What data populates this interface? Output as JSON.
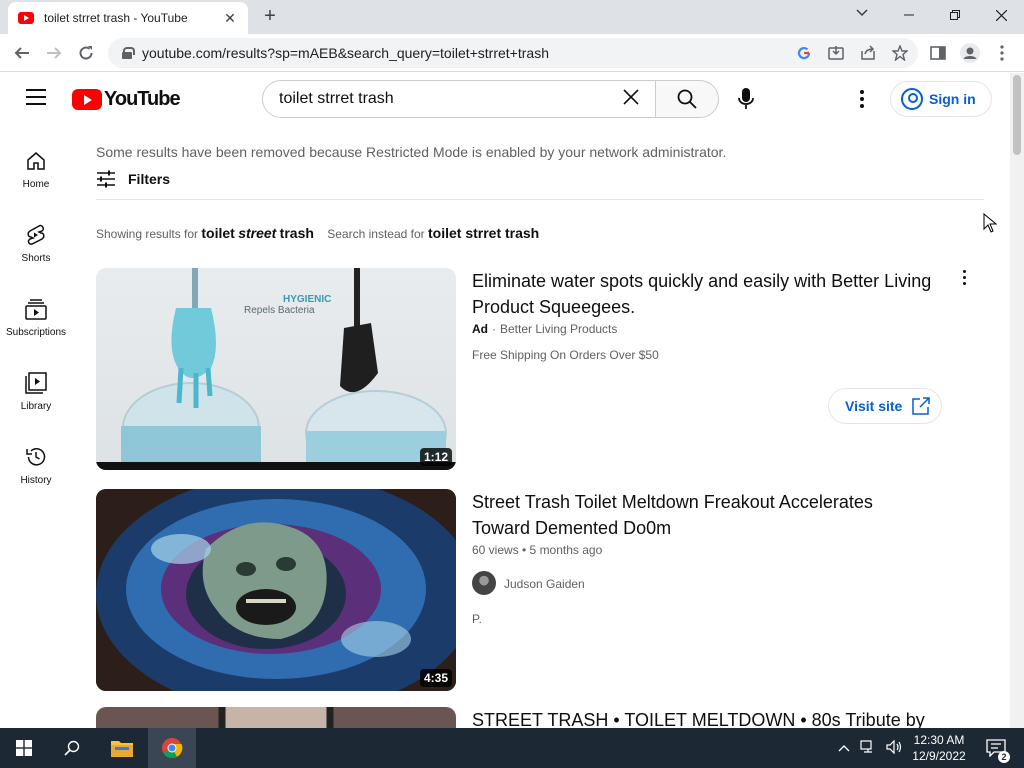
{
  "browser": {
    "tab_title": "toilet strret trash - YouTube",
    "url": "youtube.com/results?sp=mAEB&search_query=toilet+strret+trash"
  },
  "header": {
    "logo_text": "YouTube",
    "search_value": "toilet strret trash",
    "signin_label": "Sign in"
  },
  "guide": {
    "items": [
      {
        "label": "Home"
      },
      {
        "label": "Shorts"
      },
      {
        "label": "Subscriptions"
      },
      {
        "label": "Library"
      },
      {
        "label": "History"
      }
    ]
  },
  "notice": {
    "restricted": "Some results have been removed because Restricted Mode is enabled by your network administrator.",
    "filters_label": "Filters"
  },
  "correction": {
    "showing_prefix": "Showing results for",
    "showing_query_a": "toilet",
    "showing_query_b": "street",
    "showing_query_c": "trash",
    "instead_prefix": "Search instead for",
    "instead_query": "toilet strret trash"
  },
  "results": [
    {
      "title_line1": "Eliminate water spots quickly and easily with Better Living",
      "title_line2": "Product Squeegees.",
      "ad_badge": "Ad",
      "advertiser": "Better Living Products",
      "description": "Free Shipping On Orders Over $50",
      "visit_label": "Visit site",
      "duration": "1:12",
      "thumb_text_1": "HYGIENIC",
      "thumb_text_2": "Repels Bacteria"
    },
    {
      "title_line1": "Street Trash Toilet Meltdown Freakout Accelerates",
      "title_line2": "Toward Demented Do0m",
      "meta": "60 views • 5 months ago",
      "channel": "Judson Gaiden",
      "snippet": "P.",
      "duration": "4:35"
    },
    {
      "title_line1": "STREET TRASH • TOILET MELTDOWN • 80s Tribute by"
    }
  ],
  "taskbar": {
    "time": "12:30 AM",
    "date": "12/9/2022",
    "notification_count": "2"
  }
}
